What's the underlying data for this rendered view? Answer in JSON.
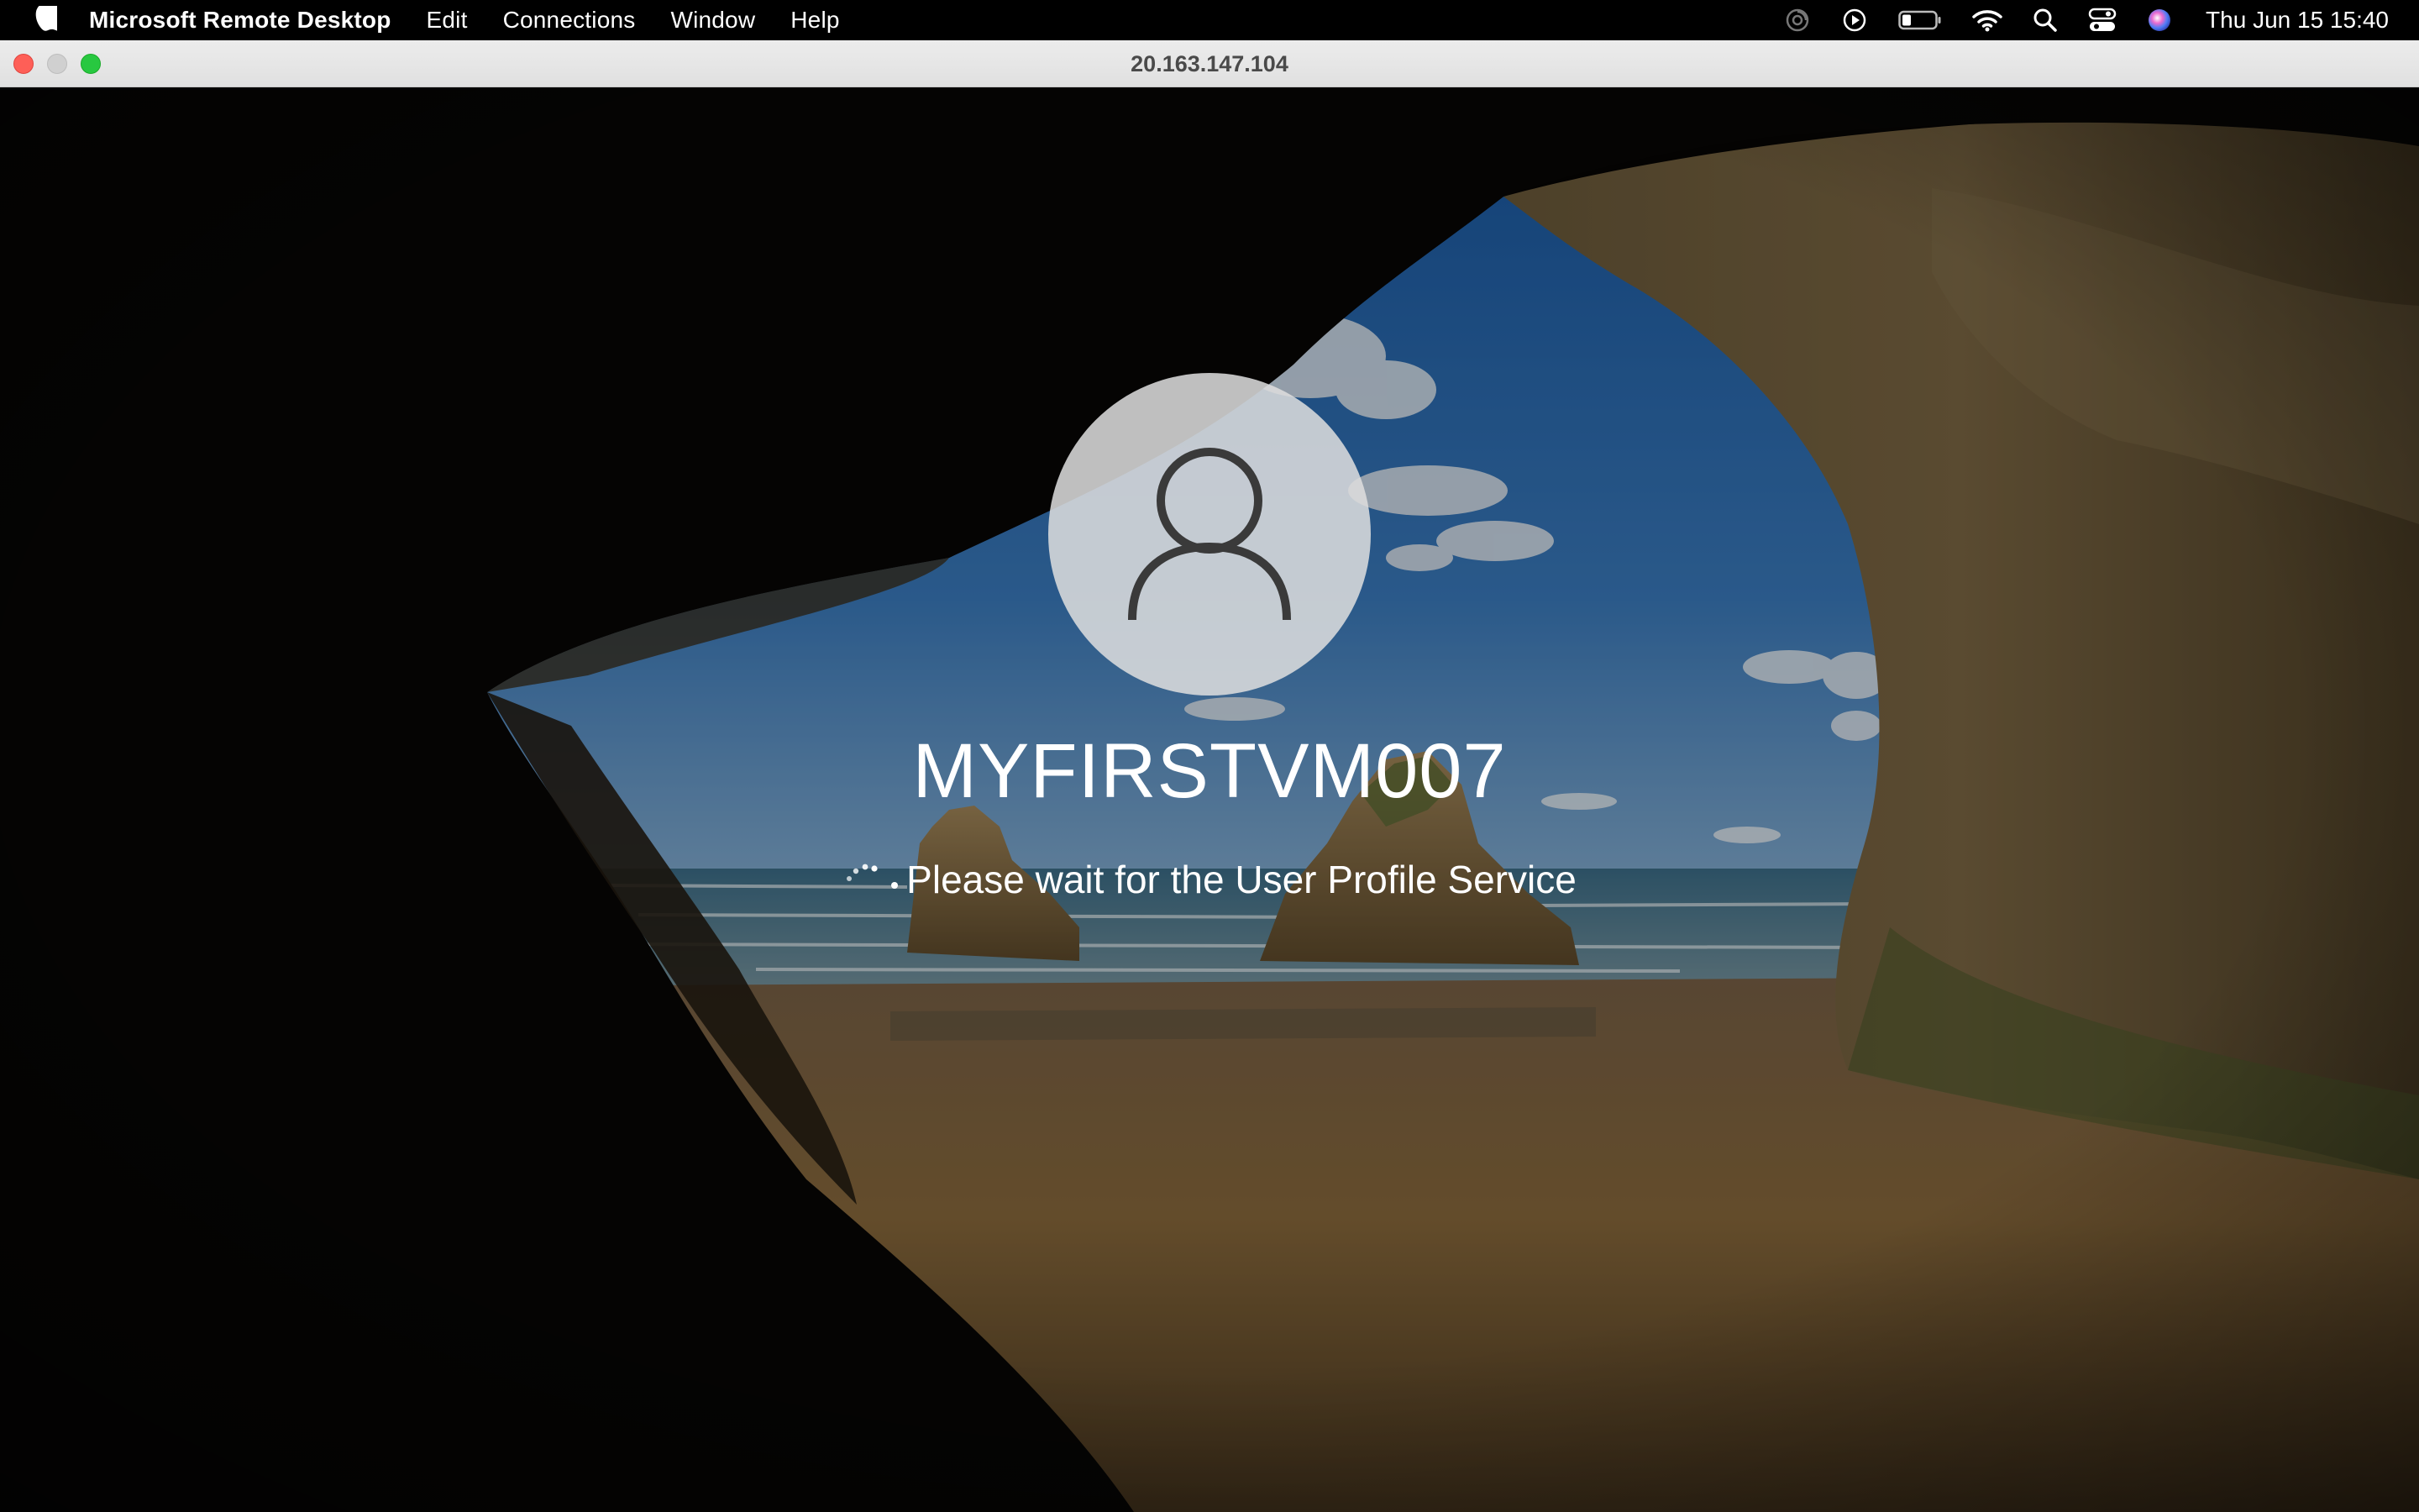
{
  "menubar": {
    "app_name": "Microsoft Remote Desktop",
    "items": [
      "Edit",
      "Connections",
      "Window",
      "Help"
    ],
    "clock": "Thu Jun 15  15:40",
    "status_icons": [
      "moon-icon",
      "play-icon",
      "battery-icon",
      "wifi-icon",
      "search-icon",
      "control-center-icon",
      "siri-icon"
    ]
  },
  "window": {
    "title": "20.163.147.104"
  },
  "login": {
    "username": "MYFIRSTVM007",
    "status": "Please wait for the User Profile Service"
  },
  "colors": {
    "close": "#fe5f57",
    "minimize": "#d0d0d0",
    "zoom": "#28c840",
    "sky": "#2f6aa8",
    "sand": "#8a6a3c",
    "rock": "#6b5a3a"
  }
}
